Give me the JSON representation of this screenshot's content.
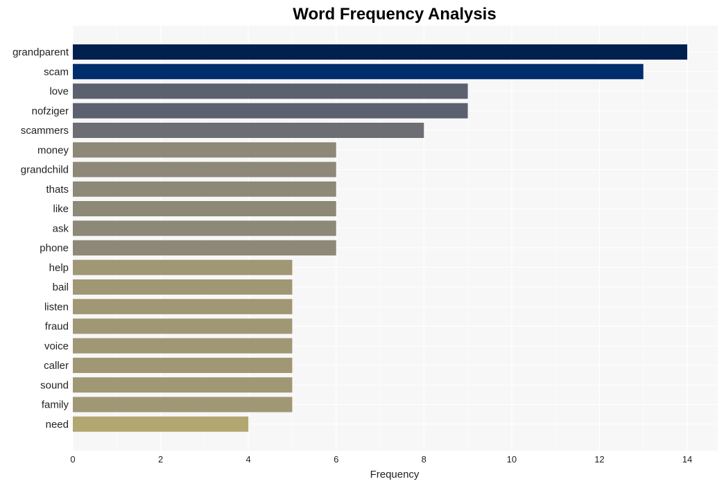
{
  "chart_data": {
    "type": "bar",
    "orientation": "horizontal",
    "title": "Word Frequency Analysis",
    "xlabel": "Frequency",
    "ylabel": "",
    "xlim": [
      0,
      14.7
    ],
    "xticks": [
      0,
      2,
      4,
      6,
      8,
      10,
      12,
      14
    ],
    "grid": true,
    "categories": [
      "grandparent",
      "scam",
      "love",
      "nofziger",
      "scammers",
      "money",
      "grandchild",
      "thats",
      "like",
      "ask",
      "phone",
      "help",
      "bail",
      "listen",
      "fraud",
      "voice",
      "caller",
      "sound",
      "family",
      "need"
    ],
    "values": [
      14,
      13,
      9,
      9,
      8,
      6,
      6,
      6,
      6,
      6,
      6,
      5,
      5,
      5,
      5,
      5,
      5,
      5,
      5,
      4
    ],
    "colors": [
      "#00204f",
      "#002d6b",
      "#5c6170",
      "#5c6170",
      "#6d6e73",
      "#8d8877",
      "#8d8877",
      "#8d8877",
      "#8d8877",
      "#8d8877",
      "#8d8877",
      "#a09775",
      "#a09775",
      "#a09775",
      "#a09775",
      "#a09775",
      "#a09775",
      "#a09775",
      "#a09775",
      "#b2a771"
    ],
    "plot_background": "#f7f7f7",
    "grid_color": "#ffffff"
  }
}
